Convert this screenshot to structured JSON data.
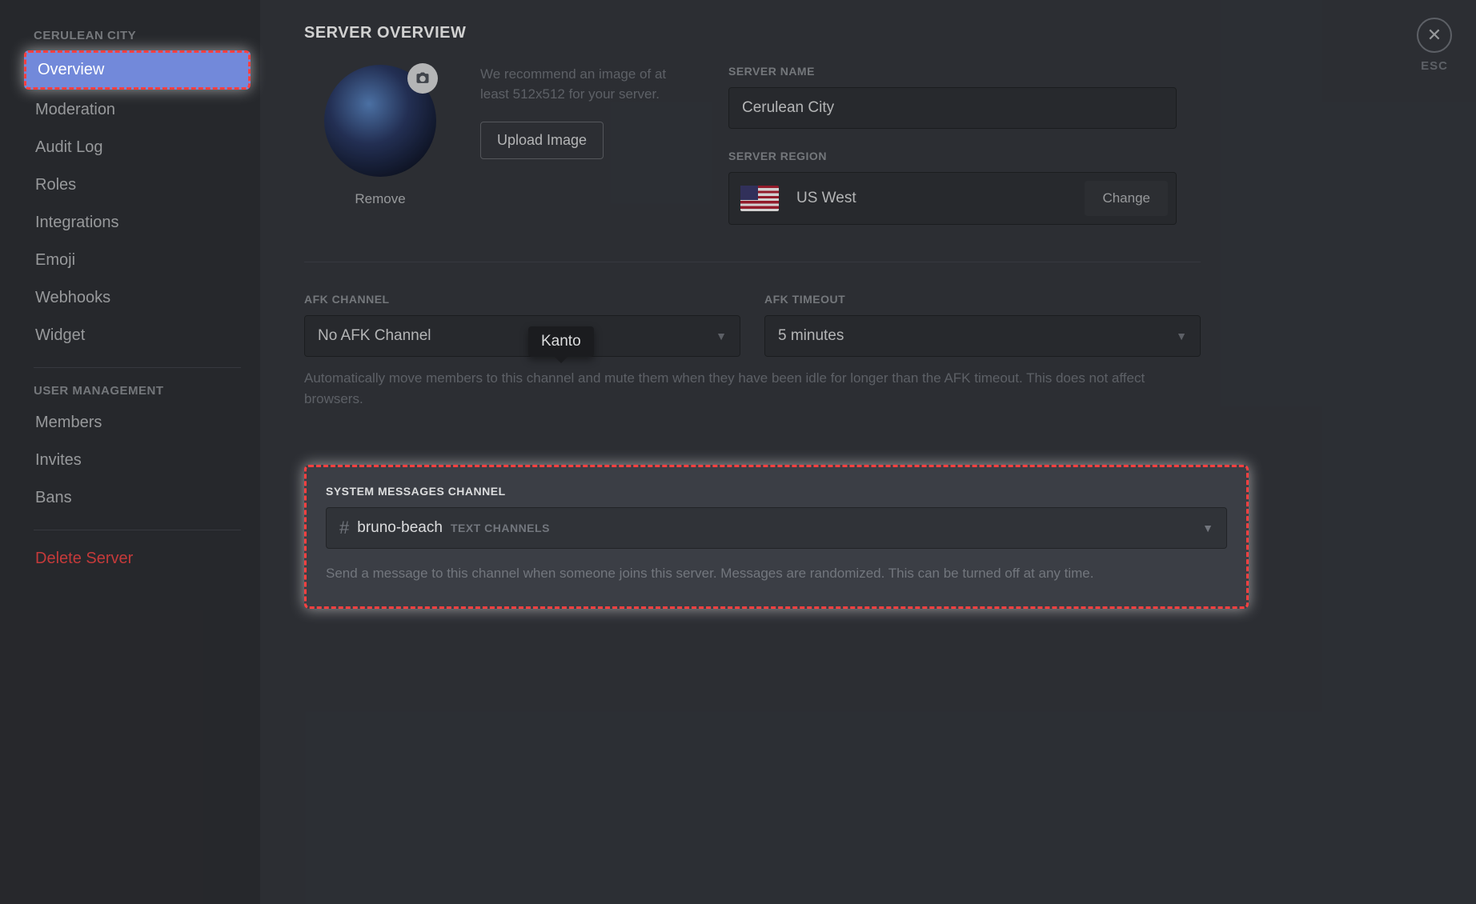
{
  "sidebar": {
    "server_header": "Cerulean City",
    "items": [
      {
        "label": "Overview",
        "selected": true,
        "highlighted": true
      },
      {
        "label": "Moderation"
      },
      {
        "label": "Audit Log"
      },
      {
        "label": "Roles"
      },
      {
        "label": "Integrations"
      },
      {
        "label": "Emoji"
      },
      {
        "label": "Webhooks"
      },
      {
        "label": "Widget"
      }
    ],
    "user_mgmt_header": "User Management",
    "user_mgmt_items": [
      {
        "label": "Members"
      },
      {
        "label": "Invites"
      },
      {
        "label": "Bans"
      }
    ],
    "delete": "Delete Server"
  },
  "esc": {
    "label": "ESC"
  },
  "page": {
    "title": "SERVER OVERVIEW",
    "recommend": "We recommend an image of at least 512x512 for your server.",
    "upload_btn": "Upload Image",
    "remove": "Remove",
    "server_name_label": "Server Name",
    "server_name_value": "Cerulean City",
    "server_region_label": "Server Region",
    "region_value": "US West",
    "change_btn": "Change",
    "afk_channel_label": "AFK Channel",
    "afk_channel_value": "No AFK Channel",
    "afk_timeout_label": "AFK Timeout",
    "afk_timeout_value": "5 minutes",
    "afk_desc": "Automatically move members to this channel and mute them when they have been idle for longer than the AFK timeout. This does not affect browsers.",
    "tooltip": "Kanto",
    "sys_label": "System Messages Channel",
    "sys_channel": "bruno-beach",
    "sys_category": "Text Channels",
    "sys_desc": "Send a message to this channel when someone joins this server. Messages are randomized. This can be turned off at any time."
  }
}
